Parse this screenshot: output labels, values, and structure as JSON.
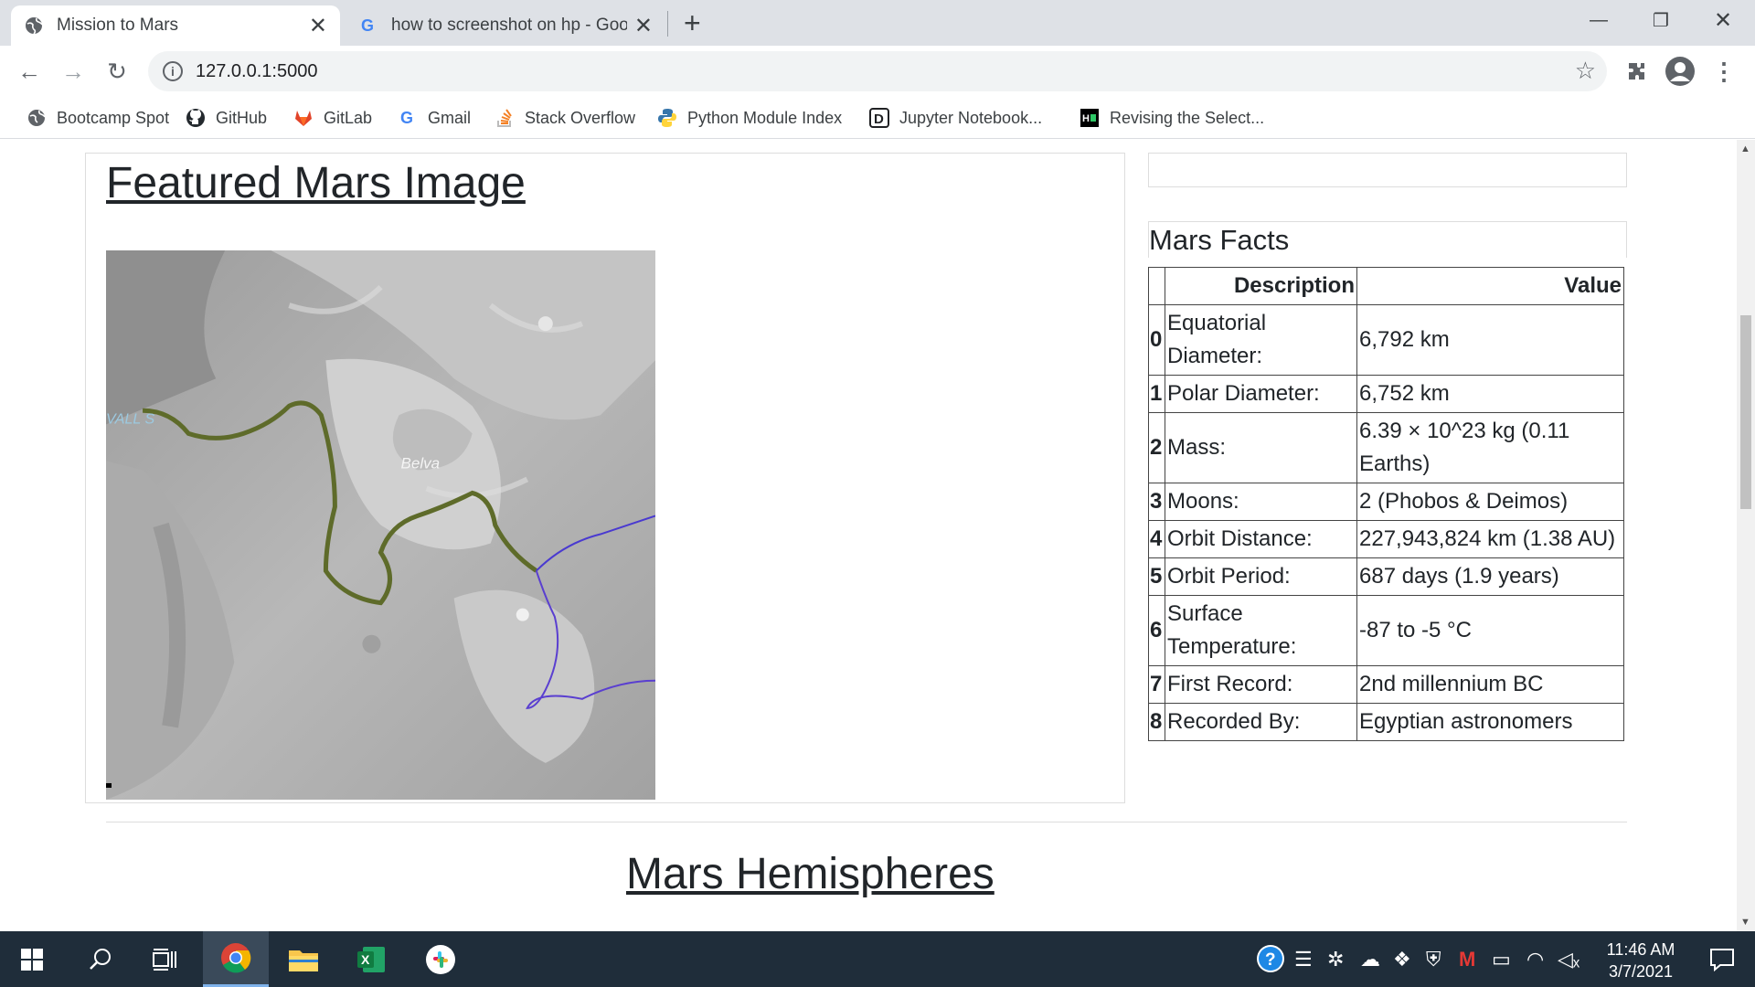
{
  "browser": {
    "tabs": [
      {
        "title": "Mission to Mars"
      },
      {
        "title": "how to screenshot on hp - Google"
      }
    ],
    "address": "127.0.0.1:5000"
  },
  "bookmarks": [
    {
      "label": "Bootcamp Spot",
      "icon": "bootcamp-icon"
    },
    {
      "label": "GitHub",
      "icon": "github-icon"
    },
    {
      "label": "GitLab",
      "icon": "gitlab-icon"
    },
    {
      "label": "Gmail",
      "icon": "google-icon"
    },
    {
      "label": "Stack Overflow",
      "icon": "stackoverflow-icon"
    },
    {
      "label": "Python Module Index",
      "icon": "python-icon"
    },
    {
      "label": "Jupyter Notebook...",
      "icon": "jupyter-icon"
    },
    {
      "label": "Revising the Select...",
      "icon": "hackerrank-icon"
    }
  ],
  "featured": {
    "title": "Featured Mars Image",
    "map_labels": [
      "VALL S",
      "Belva"
    ]
  },
  "facts": {
    "title": "Mars Facts",
    "columns": [
      "Description",
      "Value"
    ],
    "rows": [
      {
        "index": "0",
        "description": "Equatorial Diameter:",
        "value": "6,792 km"
      },
      {
        "index": "1",
        "description": "Polar Diameter:",
        "value": "6,752 km"
      },
      {
        "index": "2",
        "description": "Mass:",
        "value": "6.39 × 10^23 kg (0.11 Earths)"
      },
      {
        "index": "3",
        "description": "Moons:",
        "value": "2 (Phobos & Deimos)"
      },
      {
        "index": "4",
        "description": "Orbit Distance:",
        "value": "227,943,824 km (1.38 AU)"
      },
      {
        "index": "5",
        "description": "Orbit Period:",
        "value": "687 days (1.9 years)"
      },
      {
        "index": "6",
        "description": "Surface Temperature:",
        "value": "-87 to -5 °C"
      },
      {
        "index": "7",
        "description": "First Record:",
        "value": "2nd millennium BC"
      },
      {
        "index": "8",
        "description": "Recorded By:",
        "value": "Egyptian astronomers"
      }
    ]
  },
  "hemispheres": {
    "title": "Mars Hemispheres"
  },
  "taskbar": {
    "time": "11:46 AM",
    "date": "3/7/2021"
  },
  "colors": {
    "tabstrip": "#dee1e6",
    "taskbar": "#1f2d3a",
    "rover_path": "#6b7a2a",
    "boundary": "#5a3fd0"
  }
}
